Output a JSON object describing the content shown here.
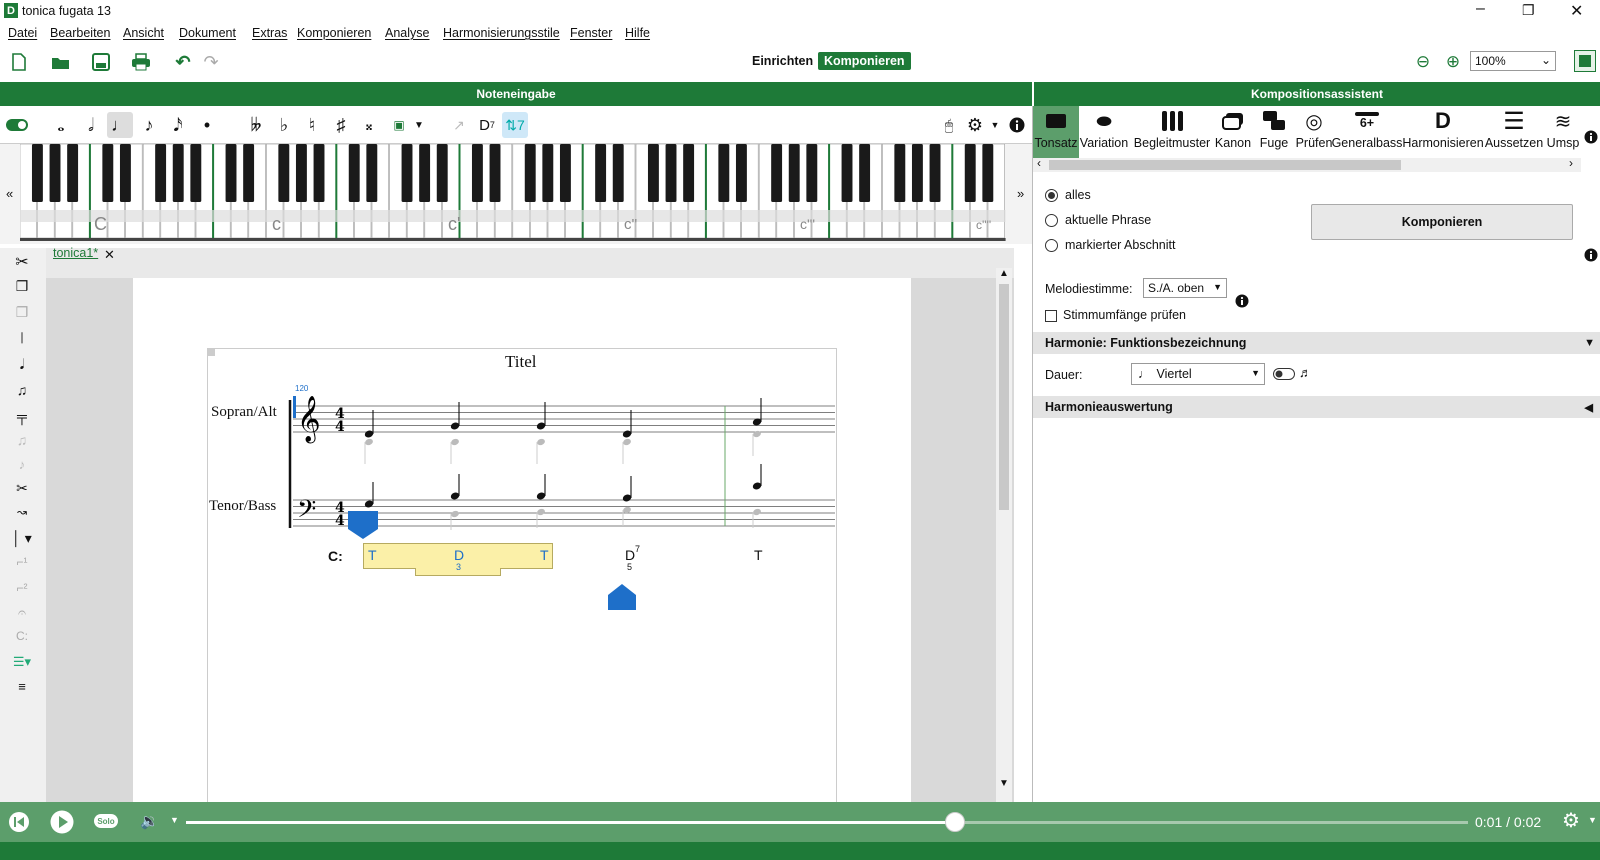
{
  "window": {
    "title": "tonica fugata 13",
    "logo_letter": "D"
  },
  "menu": [
    "Datei",
    "Bearbeiten",
    "Ansicht",
    "Dokument",
    "Extras",
    "Komponieren",
    "Analyse",
    "Harmonisierungsstile",
    "Fenster",
    "Hilfe"
  ],
  "toolbar": {
    "mode_setup": "Einrichten",
    "mode_compose": "Komponieren",
    "zoom": "100%"
  },
  "panels": {
    "note_input": "Noteneingabe",
    "assistant": "Kompositionsassistent"
  },
  "notebar": {
    "dominant_label": "D",
    "dominant_sup": "7",
    "dominant_active": "7"
  },
  "keyboard": {
    "octave_labels": [
      "C",
      "c",
      "c'",
      "c''",
      "c'''",
      "c''''"
    ],
    "left_arrow": "«",
    "right_arrow": "»"
  },
  "tab": {
    "name": "tonica1*",
    "close": "✕"
  },
  "score": {
    "title": "Titel",
    "tempo": "120",
    "staff_upper": "Sopran/Alt",
    "staff_lower": "Tenor/Bass",
    "time_sig": "4",
    "key": "C:",
    "functions": [
      "T",
      "D",
      "T",
      "D",
      "T"
    ],
    "function_sub": [
      "3",
      "5"
    ],
    "function_sup": "7"
  },
  "assistant": {
    "tools": [
      "Tonsatz",
      "Variation",
      "Begleitmuster",
      "Kanon",
      "Fuge",
      "Prüfen",
      "Generalbass",
      "Harmonisieren",
      "Aussetzen",
      "Umsp"
    ],
    "generalbass_icon_text": "6+",
    "harmonisieren_icon_text": "D",
    "scope_options": [
      "alles",
      "aktuelle Phrase",
      "markierter Abschnitt"
    ],
    "scope_selected": "alles",
    "compose_button": "Komponieren",
    "melody_label": "Melodiestimme:",
    "melody_value": "S./A. oben",
    "check_ranges": "Stimmumfänge prüfen",
    "section_harmony": "Harmonie: Funktionsbezeichnung",
    "duration_label": "Dauer:",
    "duration_value": "Viertel",
    "section_eval": "Harmonieauswertung"
  },
  "playback": {
    "time": "0:01 / 0:02",
    "solo": "Solo",
    "progress": 0.6
  }
}
